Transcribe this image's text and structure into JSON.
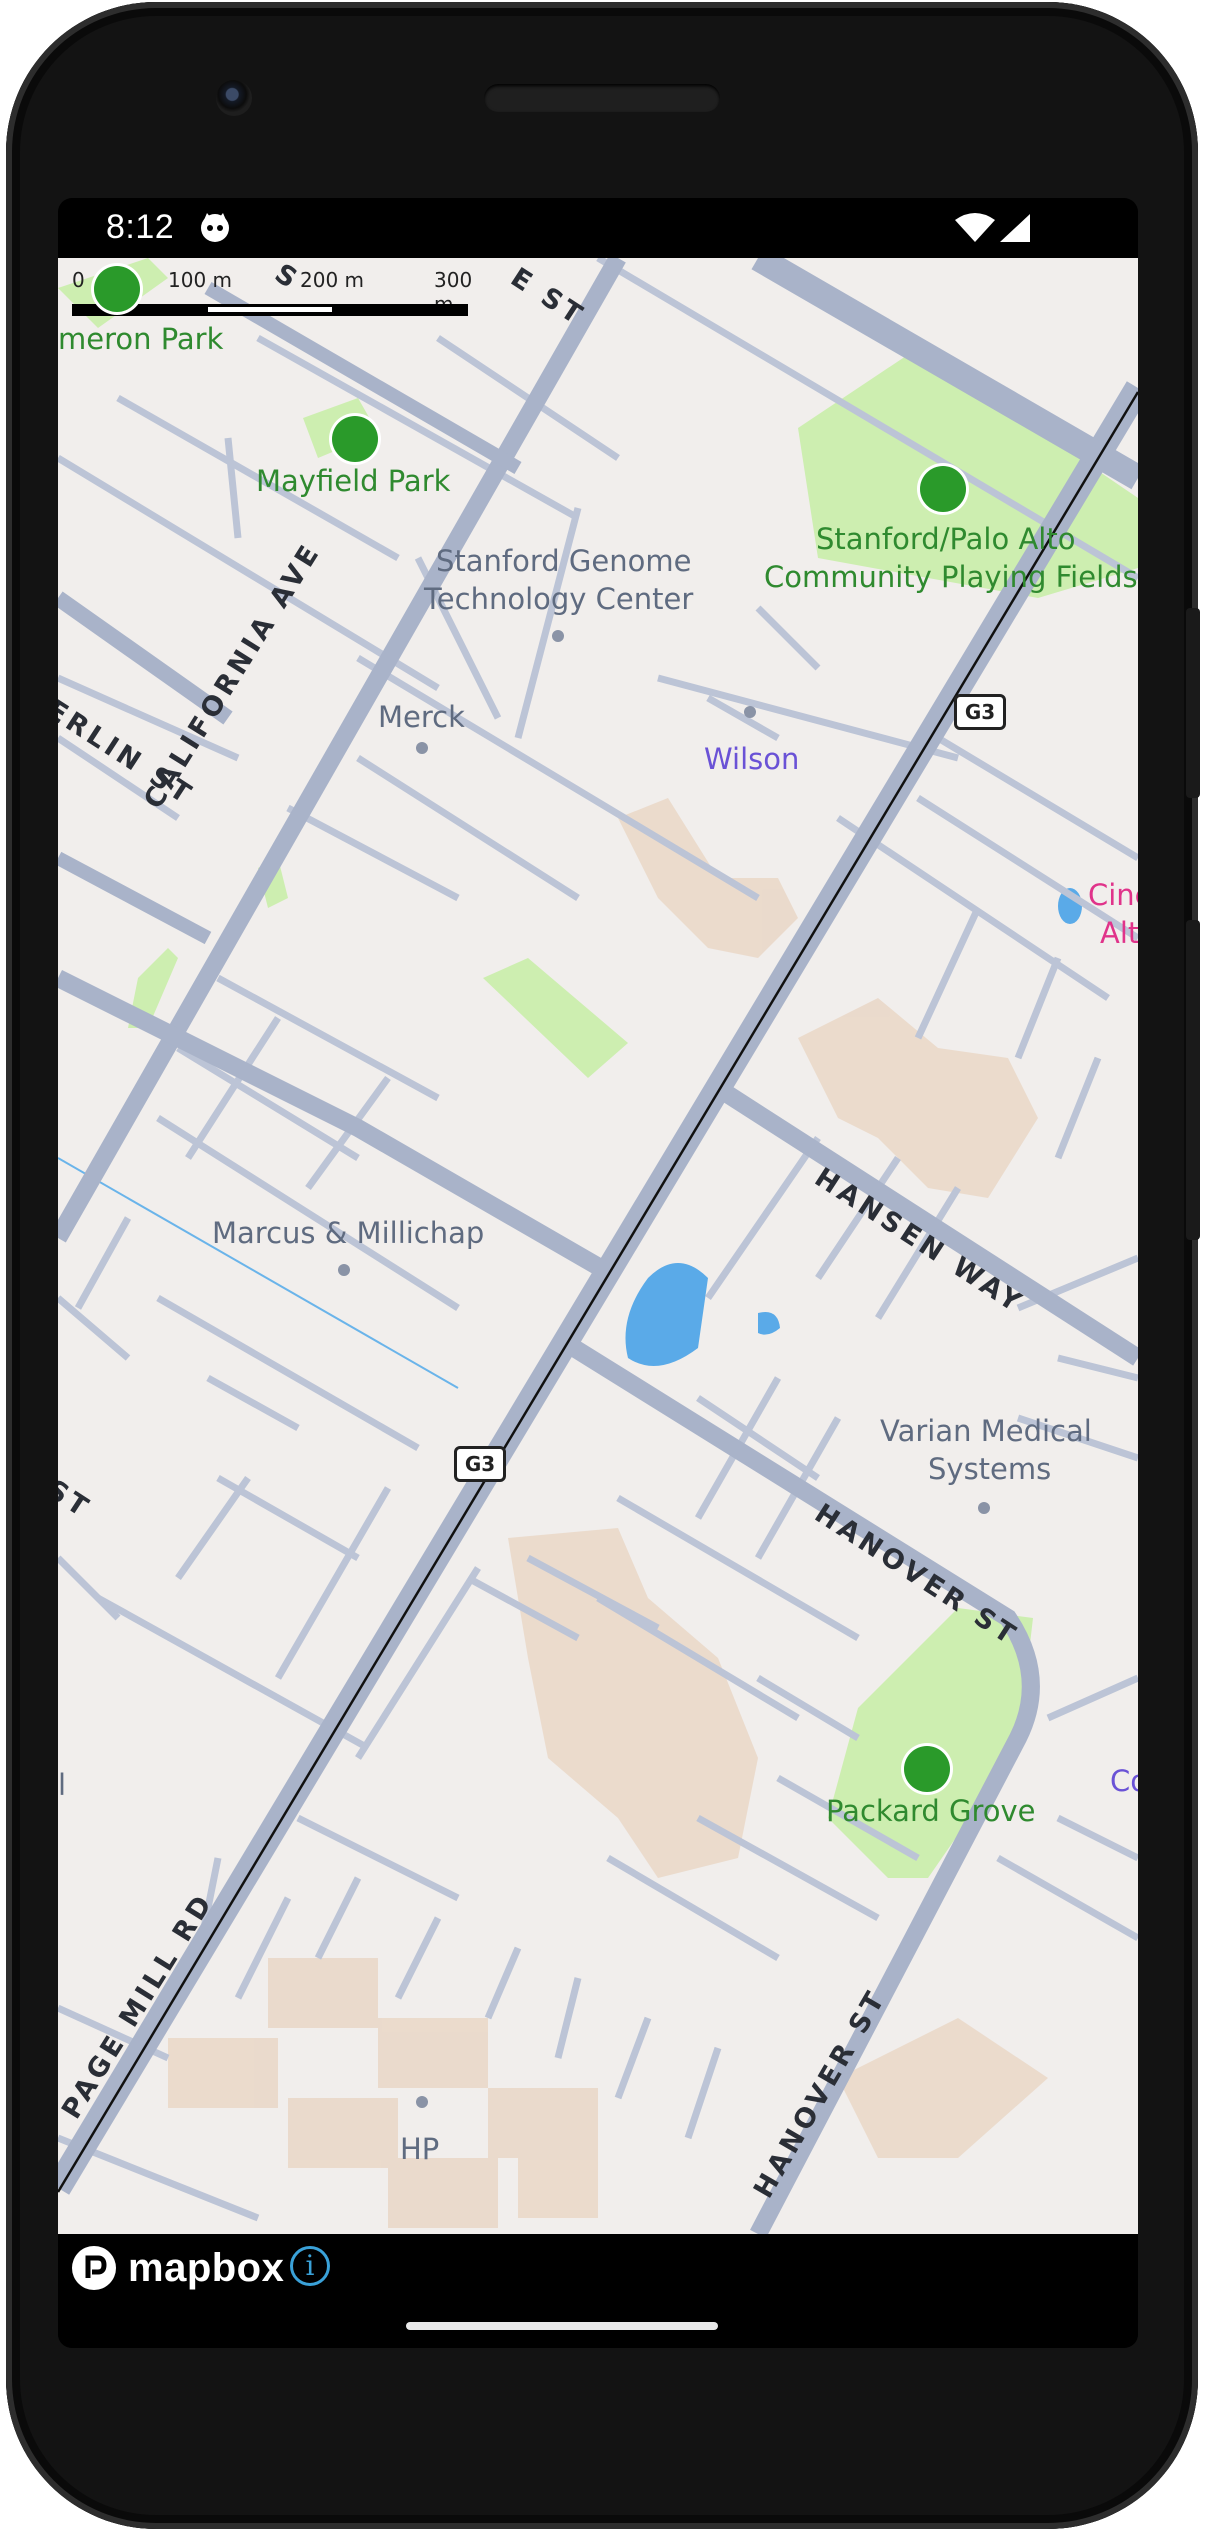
{
  "status_bar": {
    "time": "8:12"
  },
  "scale": {
    "ticks": [
      "0",
      "100 m",
      "200 m",
      "300 m"
    ]
  },
  "map": {
    "poi_labels": {
      "stanford_genome_1": "Stanford Genome",
      "stanford_genome_2": "Technology Center",
      "merck": "Merck",
      "marcus": "Marcus & Millichap",
      "varian_1": "Varian Medical",
      "varian_2": "Systems",
      "hp": "HP"
    },
    "park_labels": {
      "cameron": "meron Park",
      "mayfield": "Mayfield Park",
      "playing_1": "Stanford/Palo Alto",
      "playing_2": "Community Playing Fields",
      "packard": "Packard Grove"
    },
    "purple_labels": {
      "wilson": "Wilson",
      "co": "Co"
    },
    "pink_labels": {
      "cine_1": "Cine",
      "cine_2": "Alt"
    },
    "street_labels": {
      "california": "CALIFORNIA AVE",
      "hansen": "HANSEN WAY",
      "hanover_st_upper": "HANOVER ST",
      "hanover_st_lower": "HANOVER ST",
      "page_mill": "PAGE MILL RD",
      "erlin": "ERLIN ST",
      "st_left": "ST",
      "partial_top": "S",
      "partial_top2": "E ST",
      "left_l": "l"
    },
    "route_shield": "G3"
  },
  "attribution": {
    "brand": "mapbox",
    "info_glyph": "i"
  },
  "colors": {
    "land": "#f1eeec",
    "road": "#b7bfd3",
    "major_road": "#a9b3c9",
    "park": "#cdeeb0",
    "building": "#e9dcd3",
    "water": "#5aaae8"
  }
}
